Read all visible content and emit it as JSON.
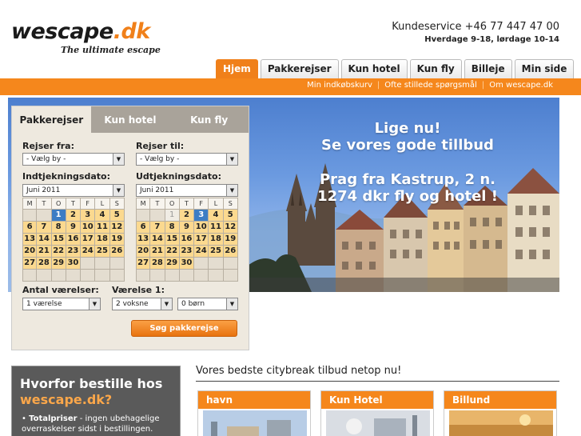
{
  "brand": {
    "name": "wescape",
    "tld": ".dk",
    "tagline": "The ultimate escape",
    "accent": "#f5871c"
  },
  "service": {
    "phone": "Kundeservice +46 77 447 47 00",
    "hours": "Hverdage 9-18, lørdage 10-14"
  },
  "nav": {
    "tabs": [
      "Hjem",
      "Pakkerejser",
      "Kun hotel",
      "Kun fly",
      "Billeje",
      "Min side"
    ],
    "active": "Hjem"
  },
  "sublinks": [
    "Min indkøbskurv",
    "Ofte stillede spørgsmål",
    "Om wescape.dk"
  ],
  "hero": {
    "line1": "Lige nu!",
    "line2": "Se vores gode tillbud",
    "line3": "Prag fra Kastrup, 2 n.",
    "line4": "1274 dkr fly og hotel !"
  },
  "search": {
    "tabs": [
      "Pakkerejser",
      "Kun hotel",
      "Kun fly"
    ],
    "from_label": "Rejser fra:",
    "from_value": "- Vælg by -",
    "to_label": "Rejser til:",
    "to_value": "- Vælg by -",
    "checkin_label": "Indtjekningsdato:",
    "checkin_month": "Juni 2011",
    "checkout_label": "Udtjekningsdato:",
    "checkout_month": "Juni 2011",
    "weekdays": [
      "M",
      "T",
      "O",
      "T",
      "F",
      "L",
      "S"
    ],
    "rooms_label": "Antal værelser:",
    "rooms_value": "1 værelse",
    "room1_label": "Værelse 1:",
    "adults_value": "2 voksne",
    "children_value": "0 børn",
    "button": "Søg pakkerejse"
  },
  "calendar_in": {
    "past": [],
    "selected": 1
  },
  "calendar_out": {
    "past": [
      1
    ],
    "selected": 3
  },
  "why": {
    "title1": "Hvorfor bestille hos",
    "title2": "wescape.dk?",
    "bullet_bold": "Totalpriser",
    "bullet_text": " - ingen ubehagelige overraskelser sidst i bestillingen."
  },
  "offers": {
    "title": "Vores bedste citybreak tilbud netop nu!",
    "cards": [
      "havn",
      "Kun Hotel",
      "Billund"
    ]
  }
}
